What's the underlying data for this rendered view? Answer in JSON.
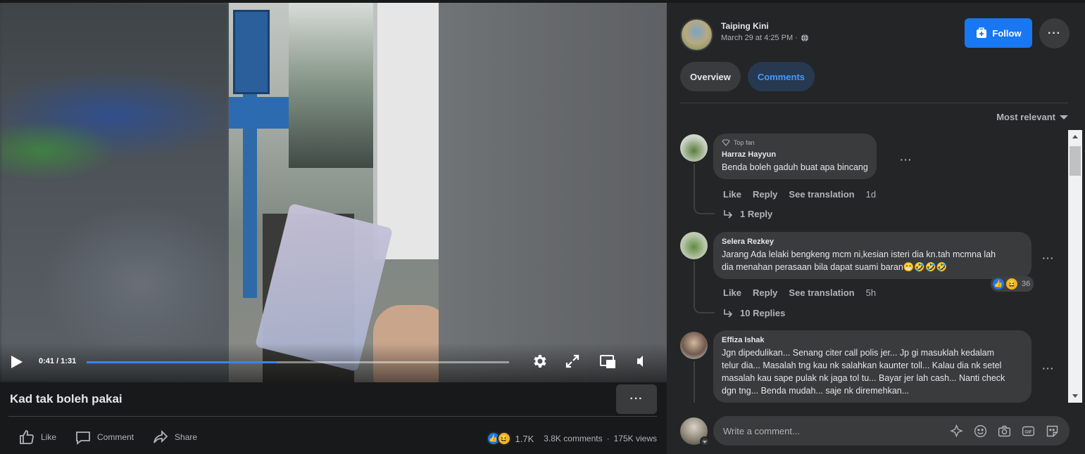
{
  "video": {
    "time": "0:41 / 1:31",
    "progress": 0.45
  },
  "post": {
    "title": "Kad tak boleh pakai",
    "more_label": "···",
    "actions": {
      "like": "Like",
      "comment": "Comment",
      "share": "Share"
    },
    "stats": {
      "reactions": "1.7K",
      "comments": "3.8K comments",
      "dot": "·",
      "views": "175K views"
    }
  },
  "page": {
    "name": "Taiping Kini",
    "date": "March 29 at 4:25 PM ·",
    "follow_label": "Follow",
    "more_label": "···"
  },
  "tabs": [
    {
      "label": "Overview",
      "active": false
    },
    {
      "label": "Comments",
      "active": true
    }
  ],
  "sort_label": "Most relevant",
  "comments": [
    {
      "badge": "Top fan",
      "author": "Harraz Hayyun",
      "text": "Benda boleh gaduh buat apa bincang",
      "like": "Like",
      "reply": "Reply",
      "translate": "See translation",
      "age": "1d",
      "replies": "1 Reply"
    },
    {
      "author": "Selera Rezkey",
      "text": "Jarang Ada lelaki bengkeng mcm ni,kesian isteri dia kn.tah mcmna lah\ndia menahan perasaan bila dapat suami baran😁🤣🤣🤣",
      "reaction_count": "36",
      "like": "Like",
      "reply": "Reply",
      "translate": "See translation",
      "age": "5h",
      "replies": "10 Replies"
    },
    {
      "author": "Effiza Ishak",
      "text": "Jgn dipedulikan... Senang citer call polis jer... Jp gi masuklah kedalam\ntelur dia... Masalah tng kau nk salahkan kaunter toll... Kalau dia nk setel\nmasalah kau sape pulak nk jaga tol tu... Bayar jer lah cash... Nanti check\ndgn tng... Benda mudah... saje nk diremehkan..."
    }
  ],
  "composer": {
    "placeholder": "Write a comment..."
  },
  "colors": {
    "accent": "#1877f2",
    "tab_active_bg": "#263951",
    "tab_active_fg": "#4599ff",
    "bubble": "#3a3b3c",
    "panel": "#242526"
  },
  "icons": [
    "play-icon",
    "gear-icon",
    "fullscreen-icon",
    "pip-icon",
    "volume-icon",
    "like-icon",
    "comment-icon",
    "share-icon",
    "globe-icon",
    "follow-icon",
    "diamond-icon",
    "reply-arrow-icon",
    "avatar-icon",
    "emoji-icon",
    "camera-icon",
    "gif-icon",
    "sticker-icon"
  ]
}
